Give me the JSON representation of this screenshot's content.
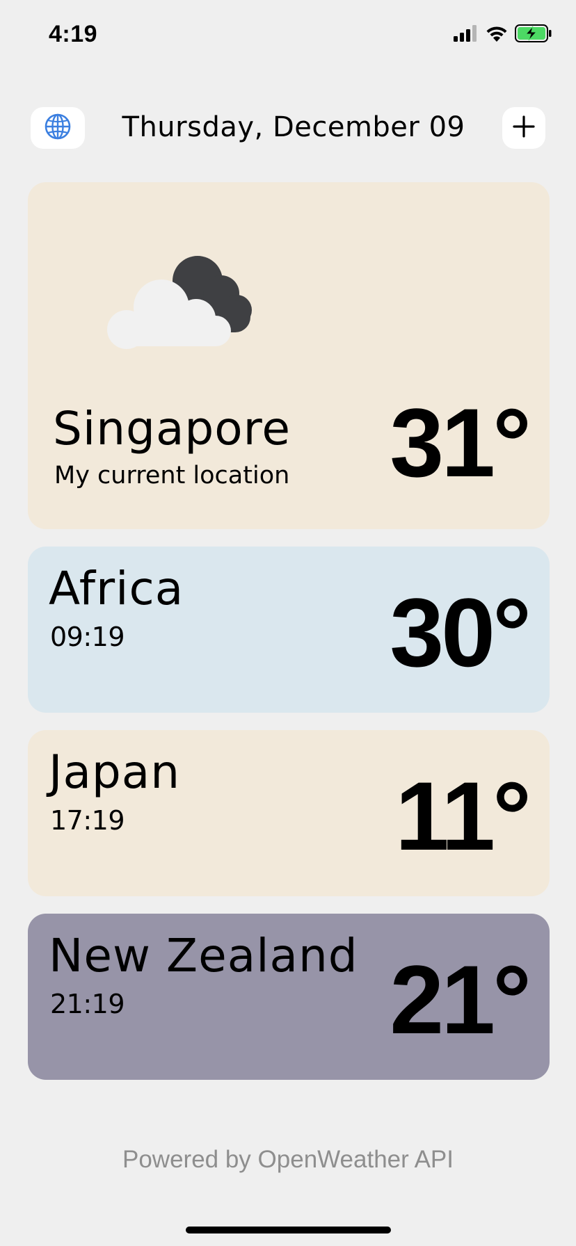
{
  "status_bar": {
    "time": "4:19",
    "icons": [
      "signal-icon",
      "wifi-icon",
      "battery-charging-icon"
    ]
  },
  "header": {
    "date": "Thursday, December 09",
    "left_button_icon": "globe-icon",
    "right_button_icon": "plus-icon"
  },
  "current": {
    "city": "Singapore",
    "subtitle": "My current location",
    "temperature": "31°",
    "icon": "partly-cloudy-night-icon",
    "background": "#f2e9da"
  },
  "locations": [
    {
      "city": "Africa",
      "time": "09:19",
      "temperature": "30°",
      "background": "#dae7ee"
    },
    {
      "city": "Japan",
      "time": "17:19",
      "temperature": "11°",
      "background": "#f2e9da"
    },
    {
      "city": "New Zealand",
      "time": "21:19",
      "temperature": "21°",
      "background": "#9794a8"
    }
  ],
  "footer": {
    "text": "Powered by OpenWeather API"
  },
  "colors": {
    "page_background": "#efefef",
    "accent_blue": "#3b7fe0",
    "footer_text": "#8e8e8e"
  }
}
